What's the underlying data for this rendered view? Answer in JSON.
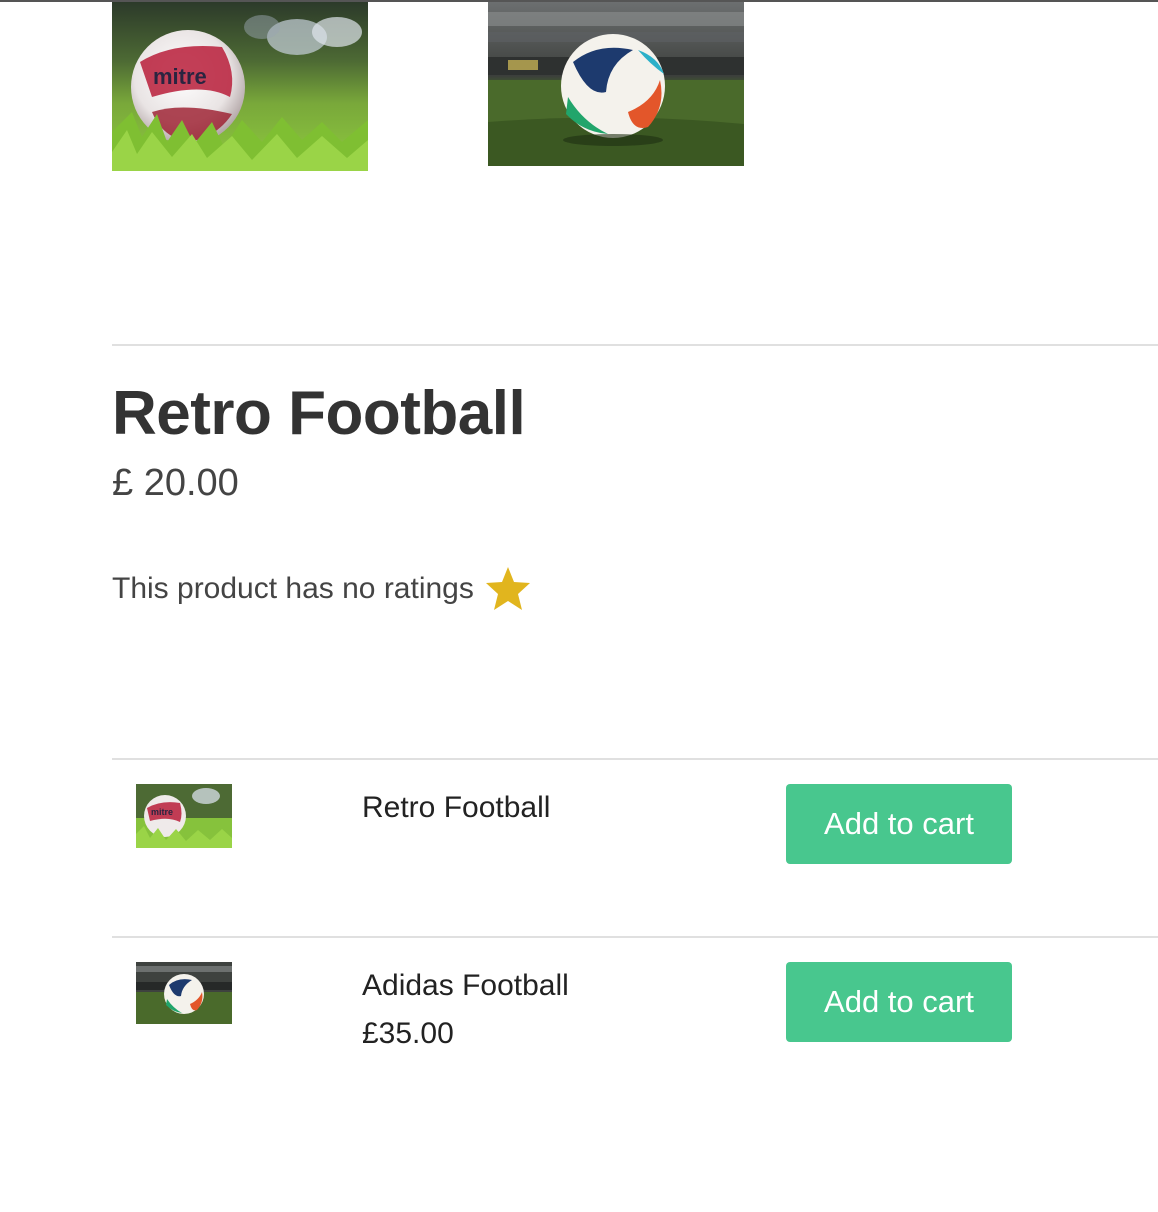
{
  "product": {
    "title": "Retro Football",
    "price": "£ 20.00",
    "rating_text": "This product has no ratings",
    "rating_icon": "star-icon",
    "star_color": "#e1b51e"
  },
  "gallery": [
    {
      "alt": "Retro Football photo"
    },
    {
      "alt": "Adidas Football photo"
    }
  ],
  "list": {
    "items": [
      {
        "name": "Retro Football",
        "price": "",
        "button_label": "Add to cart"
      },
      {
        "name": "Adidas Football",
        "price": "£35.00",
        "button_label": "Add to cart"
      }
    ]
  },
  "colors": {
    "button_bg": "#48c78e",
    "button_text": "#ffffff",
    "divider": "#e0e0e0",
    "text": "#333333"
  }
}
